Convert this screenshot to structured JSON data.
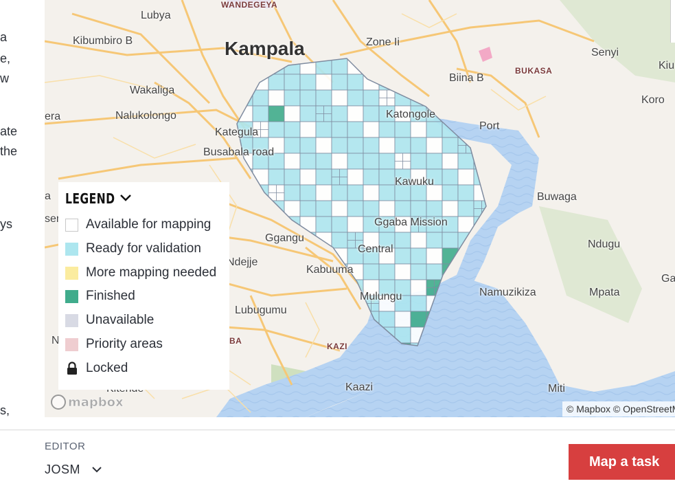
{
  "left_text_fragments": [
    "a",
    "e,",
    "w",
    "ate",
    "the",
    "ys",
    "s,"
  ],
  "map": {
    "places": [
      {
        "id": "wandegeya",
        "label": "WANDEGEYA",
        "style": "red"
      },
      {
        "id": "lubya",
        "label": "Lubya"
      },
      {
        "id": "kibumbiro",
        "label": "Kibumbiro B"
      },
      {
        "id": "kampala",
        "label": "Kampala",
        "style": "big"
      },
      {
        "id": "zone",
        "label": "Zone Ii"
      },
      {
        "id": "senyi",
        "label": "Senyi"
      },
      {
        "id": "kiu",
        "label": "Kiu"
      },
      {
        "id": "bukasa",
        "label": "BUKASA",
        "style": "red"
      },
      {
        "id": "biina",
        "label": "Biina B"
      },
      {
        "id": "wakaliga",
        "label": "Wakaliga"
      },
      {
        "id": "koro",
        "label": "Koro"
      },
      {
        "id": "era",
        "label": "era"
      },
      {
        "id": "nalukolongo",
        "label": "Nalukolongo"
      },
      {
        "id": "katongole",
        "label": "Katongole"
      },
      {
        "id": "port",
        "label": "Port"
      },
      {
        "id": "kategula",
        "label": "Kategula"
      },
      {
        "id": "busabala",
        "label": "Busabala road"
      },
      {
        "id": "kawuku",
        "label": "Kawuku"
      },
      {
        "id": "buwaga",
        "label": "Buwaga"
      },
      {
        "id": "a",
        "label": "a"
      },
      {
        "id": "ser",
        "label": "ser"
      },
      {
        "id": "ggaba",
        "label": "Ggaba Mission"
      },
      {
        "id": "ggangu",
        "label": "Ggangu"
      },
      {
        "id": "ndugu",
        "label": "Ndugu"
      },
      {
        "id": "central",
        "label": "Central"
      },
      {
        "id": "ndejje",
        "label": "Ndejje"
      },
      {
        "id": "kabuuma",
        "label": "Kabuuma"
      },
      {
        "id": "ga",
        "label": "Ga"
      },
      {
        "id": "namuzikiza",
        "label": "Namuzikiza"
      },
      {
        "id": "mpata",
        "label": "Mpata"
      },
      {
        "id": "mulungu",
        "label": "Mulungu"
      },
      {
        "id": "lubugumu",
        "label": "Lubugumu"
      },
      {
        "id": "n",
        "label": "N"
      },
      {
        "id": "ba",
        "label": "BA",
        "style": "red"
      },
      {
        "id": "kazi",
        "label": "KAZI",
        "style": "red"
      },
      {
        "id": "kaazi",
        "label": "Kaazi"
      },
      {
        "id": "kitende",
        "label": "Kitende"
      },
      {
        "id": "miti",
        "label": "Miti"
      }
    ],
    "legend": {
      "title": "LEGEND",
      "items": [
        {
          "label": "Available for mapping",
          "color": "#ffffff",
          "border": "#c8c8c8"
        },
        {
          "label": "Ready for validation",
          "color": "#ade6ef",
          "border": "#ade6ef"
        },
        {
          "label": "More mapping needed",
          "color": "#fbec9f",
          "border": "#fbec9f"
        },
        {
          "label": "Finished",
          "color": "#40ac8c",
          "border": "#40ac8c"
        },
        {
          "label": "Unavailable",
          "color": "#d8dae4",
          "border": "#d8dae4"
        },
        {
          "label": "Priority areas",
          "color": "#efcdd0",
          "border": "#efcdd0"
        },
        {
          "label": "Locked",
          "icon": "lock-icon"
        }
      ]
    },
    "logo_text": "mapbox",
    "attribution": "© Mapbox © OpenStreetMap"
  },
  "editor": {
    "label": "EDITOR",
    "value": "JOSM"
  },
  "action": {
    "map_task_label": "Map a task"
  },
  "colors": {
    "ready": "#ade6ef",
    "finished": "#40ac8c",
    "available": "#ffffff",
    "water": "#b6d3f2",
    "button": "#d73f3f"
  }
}
